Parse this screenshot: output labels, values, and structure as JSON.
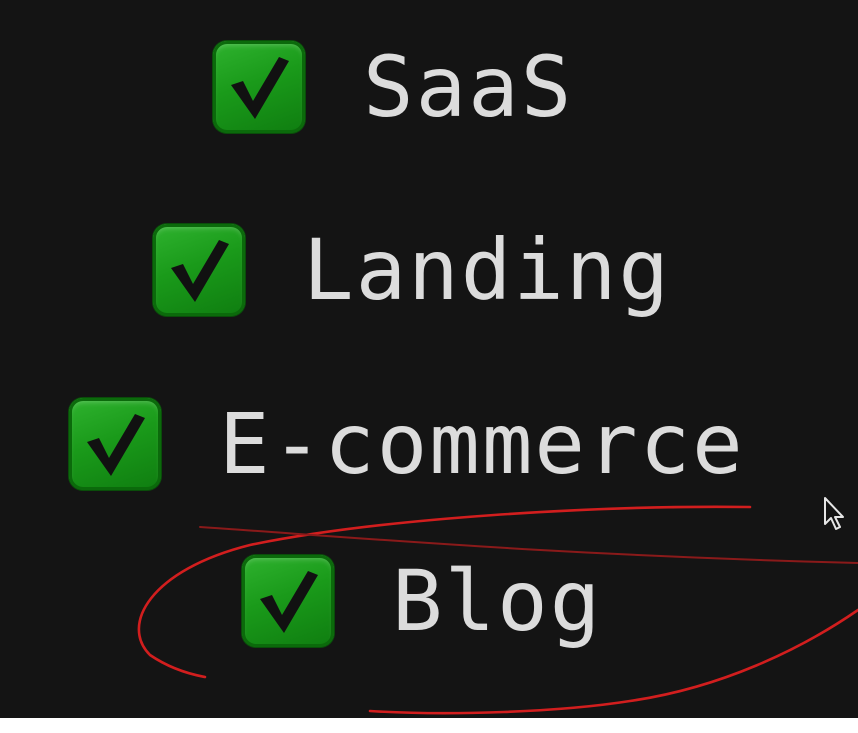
{
  "checklist": {
    "items": [
      {
        "label": "SaaS",
        "checked": true
      },
      {
        "label": "Landing",
        "checked": true
      },
      {
        "label": "E-commerce",
        "checked": true
      },
      {
        "label": "Blog",
        "checked": true
      }
    ]
  },
  "colors": {
    "background": "#141414",
    "checkbox_green": "#1a9a1a",
    "checkmark": "#111111",
    "label_text": "#dcdcdc",
    "annotation_red": "#d21e1e"
  },
  "icons": {
    "checkbox": "check-mark-icon",
    "cursor": "mouse-pointer-icon"
  }
}
